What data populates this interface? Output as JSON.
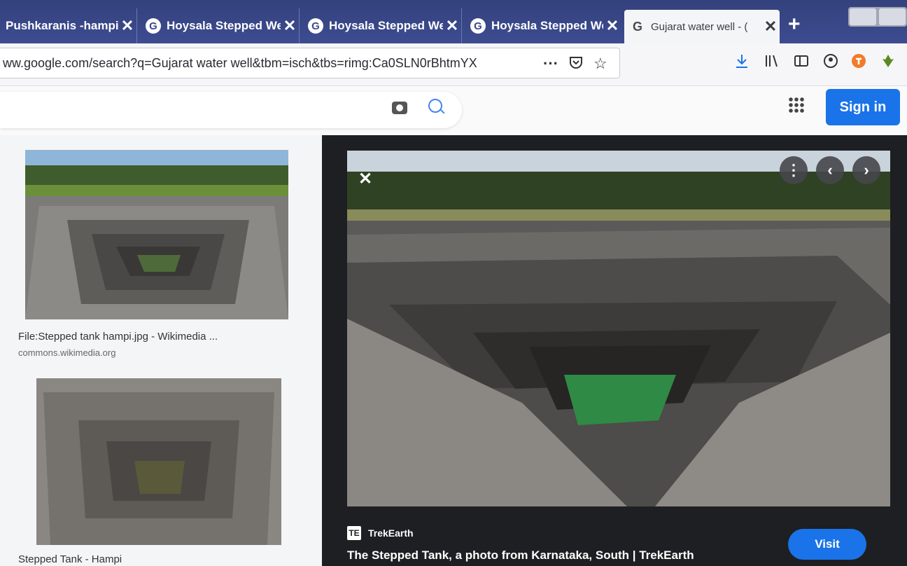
{
  "browser": {
    "tabs": [
      {
        "label": "Pushkaranis -hampi",
        "icon": "none",
        "close": "✕"
      },
      {
        "label": "Hoysala Stepped We",
        "icon": "google-favicon",
        "close": "✕"
      },
      {
        "label": "Hoysala Stepped We",
        "icon": "google-favicon",
        "close": "✕"
      },
      {
        "label": "Hoysala Stepped We",
        "icon": "google-favicon",
        "close": "✕"
      },
      {
        "label": "Gujarat water well - (",
        "icon": "google-favicon",
        "close": "✕",
        "active": true
      }
    ],
    "tab_favicon_glyph": "G",
    "new_tab": "+",
    "url": "ww.google.com/search?q=Gujarat water well&tbm=isch&tbs=rimg:Ca0SLN0rBhtmYX",
    "url_actions": {
      "more": "···",
      "pocket": "pocket-icon",
      "bookmark": "☆"
    },
    "toolbar_icons": [
      "download-icon",
      "library-icon",
      "sidebar-icon",
      "account-icon",
      "addon-orange-icon",
      "addon-green-icon"
    ]
  },
  "google": {
    "sign_in": "Sign in"
  },
  "results": [
    {
      "caption": "File:Stepped tank hampi.jpg - Wikimedia ...",
      "source": "commons.wikimedia.org"
    },
    {
      "caption": "Stepped Tank - Hampi",
      "source": ""
    }
  ],
  "preview": {
    "close": "✕",
    "source_logo": "TE",
    "source_name": "TrekEarth",
    "title": "The Stepped Tank, a photo from Karnataka, South | TrekEarth",
    "visit": "Visit",
    "more": "⋮",
    "prev": "‹",
    "next": "›"
  },
  "colors": {
    "accent": "#1a73e8",
    "tabstrip": "#3b4a8c",
    "panel": "#1e1f22"
  }
}
